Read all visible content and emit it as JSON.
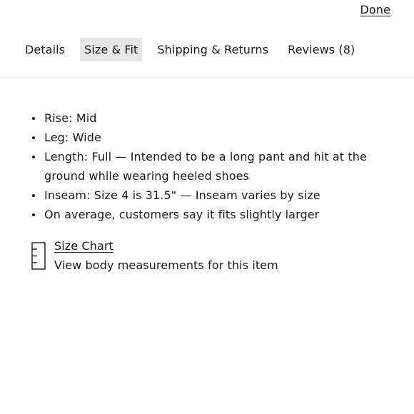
{
  "header": {
    "done_label": "Done"
  },
  "tabs": [
    {
      "label": "Details",
      "active": false
    },
    {
      "label": "Size & Fit",
      "active": true
    },
    {
      "label": "Shipping & Returns",
      "active": false
    },
    {
      "label": "Reviews (8)",
      "active": false
    }
  ],
  "size_fit": {
    "bullets": [
      "Rise: Mid",
      "Leg: Wide",
      "Length: Full — Intended to be a long pant and hit at the ground while wearing heeled shoes",
      "Inseam: Size 4 is 31.5\" — Inseam varies by size",
      "On average, customers say it fits slightly larger"
    ],
    "size_chart": {
      "icon": "ruler-icon",
      "link_label": "Size Chart",
      "description": "View body measurements for this item"
    }
  },
  "colors": {
    "text": "#1a1a1a",
    "active_tab_bg": "#e6e6e6",
    "divider": "#eeeeee",
    "background": "#ffffff"
  }
}
